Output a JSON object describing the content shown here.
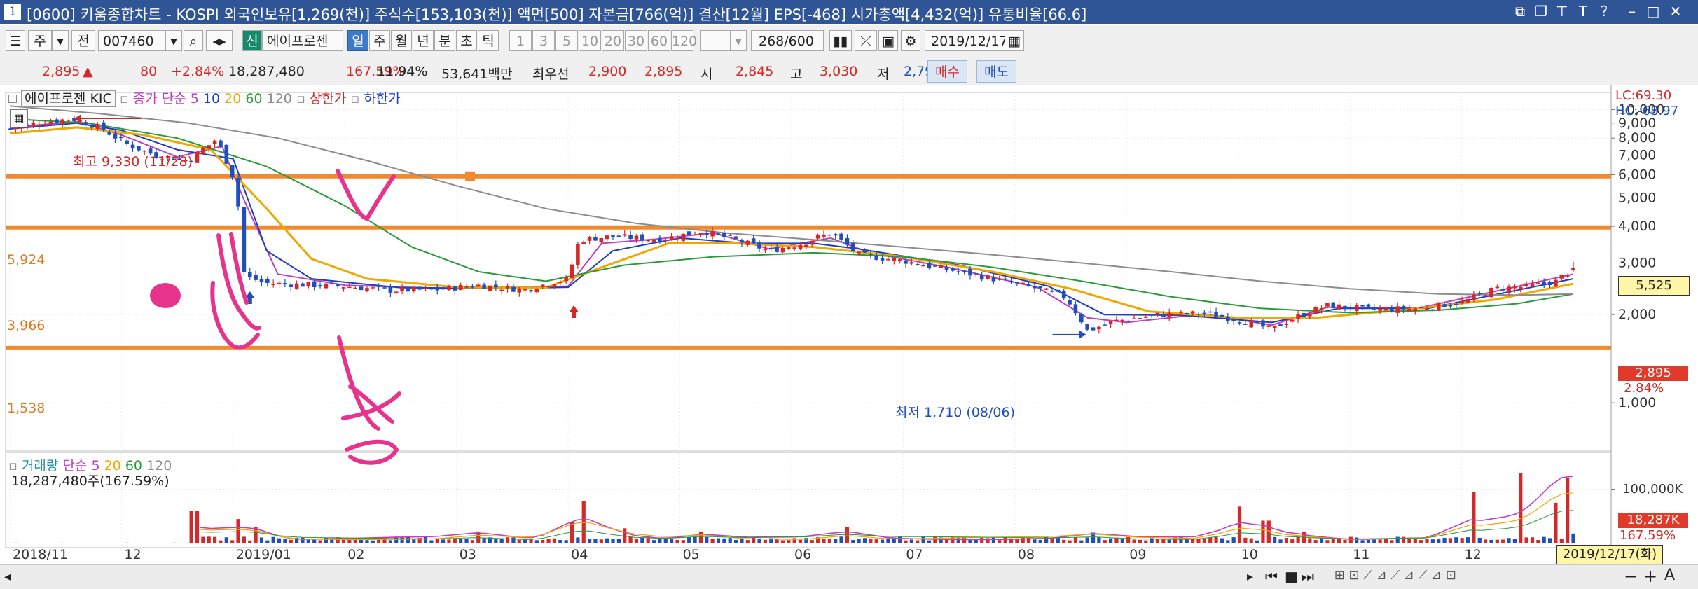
{
  "window": {
    "number": "1",
    "title": "[0600] 키움종합차트 - KOSPI 외국인보유[1,269(천)] 주식수[153,103(천)] 액면[500] 자본금[766(억)] 결산[12월] EPS[-468] 시가총액[4,432(억)] 유통비율[66.6]"
  },
  "toolbar": {
    "period_main": "주",
    "period_prev": "전",
    "stock_code": "007460",
    "stock_badge": "신",
    "stock_name": "에이프로젠",
    "periods": [
      "일",
      "주",
      "월",
      "년",
      "분",
      "초",
      "틱"
    ],
    "selected_period": "일",
    "intervals": [
      "1",
      "3",
      "5",
      "10",
      "20",
      "30",
      "60",
      "120"
    ],
    "count": "268",
    "count_max": "/600",
    "date": "2019/12/17"
  },
  "quote": {
    "price": "2,895",
    "change_arrow": "▲",
    "change": "80",
    "change_pct": "+2.84%",
    "volume": "18,287,480",
    "volume_ratio": "167.59%",
    "turnover": "11.94%",
    "trade_value": "53,641백만",
    "best_ask_label": "최우선",
    "best_ask": "2,900",
    "best_bid": "2,895",
    "open_label": "시",
    "open": "2,845",
    "high_label": "고",
    "high": "3,030",
    "low_label": "저",
    "low": "2,795",
    "buy_button": "매수",
    "sell_button": "매도"
  },
  "price_legend": {
    "stock": "에이프로젠 KIC",
    "ma_label": "종가 단순",
    "ma_periods": [
      "5",
      "10",
      "20",
      "60",
      "120"
    ],
    "upper_limit": "상한가",
    "lower_limit": "하한가",
    "lc": "LC:69.30",
    "hc": "HC:-68.97"
  },
  "volume_legend": {
    "label": "거래량",
    "ma_label": "단순",
    "ma_periods": [
      "5",
      "20",
      "60",
      "120"
    ],
    "current": "18,287,480주(167.59%)"
  },
  "annotations": {
    "high_label": "최고 9,330 (11/28)",
    "low_label": "최저 1,710 (08/06)",
    "hline_labels": [
      "5,924",
      "3,966",
      "1,538"
    ]
  },
  "axis_badges": {
    "cursor_price": "5,525",
    "last_price": "2,895",
    "last_pct": "2.84%",
    "last_volume": "18,287K",
    "last_volume_pct": "167.59%",
    "volume_axis_label": "100,000K",
    "date_badge": "2019/12/17(화)"
  },
  "colors": {
    "up": "#d62828",
    "down": "#1f4fbf",
    "ma5": "#c040c0",
    "ma10": "#1f3fbf",
    "ma20": "#f0a800",
    "ma60": "#2a9a3a",
    "ma120": "#8c8c8c",
    "hline": "#f08a30",
    "marker": "#e8338c"
  },
  "chart_data": [
    {
      "type": "candlestick",
      "title": "에이프로젠 KIC",
      "x_labels": [
        "2018/11",
        "12",
        "2019/01",
        "02",
        "03",
        "04",
        "05",
        "06",
        "07",
        "08",
        "09",
        "10",
        "11",
        "12"
      ],
      "x_label_months": [
        0,
        1,
        2,
        3,
        4,
        5,
        6,
        7,
        8,
        9,
        10,
        11,
        12,
        13
      ],
      "y_ticks": [
        1000,
        2000,
        3000,
        4000,
        5000,
        6000,
        7000,
        8000,
        9000,
        10000
      ],
      "ylim": [
        700,
        11200
      ],
      "log_scale": true,
      "close_path": [
        [
          0.0,
          8600
        ],
        [
          0.25,
          9000
        ],
        [
          0.55,
          9330
        ],
        [
          0.8,
          8700
        ],
        [
          1.05,
          7600
        ],
        [
          1.3,
          7000
        ],
        [
          1.6,
          6700
        ],
        [
          1.85,
          7900
        ],
        [
          2.02,
          5600
        ],
        [
          2.1,
          2700
        ],
        [
          2.3,
          2560
        ],
        [
          2.6,
          2530
        ],
        [
          3.0,
          2500
        ],
        [
          3.4,
          2420
        ],
        [
          3.8,
          2430
        ],
        [
          4.2,
          2520
        ],
        [
          4.6,
          2430
        ],
        [
          5.0,
          2650
        ],
        [
          5.1,
          3600
        ],
        [
          5.4,
          3700
        ],
        [
          5.8,
          3600
        ],
        [
          6.2,
          3850
        ],
        [
          6.5,
          3600
        ],
        [
          6.8,
          3300
        ],
        [
          7.1,
          3500
        ],
        [
          7.35,
          3800
        ],
        [
          7.6,
          3200
        ],
        [
          8.0,
          3050
        ],
        [
          8.4,
          2850
        ],
        [
          8.8,
          2650
        ],
        [
          9.2,
          2450
        ],
        [
          9.45,
          2300
        ],
        [
          9.65,
          1760
        ],
        [
          9.9,
          1900
        ],
        [
          10.3,
          2000
        ],
        [
          10.7,
          2020
        ],
        [
          11.0,
          1920
        ],
        [
          11.3,
          1780
        ],
        [
          11.5,
          1950
        ],
        [
          11.8,
          2150
        ],
        [
          12.2,
          2080
        ],
        [
          12.6,
          2100
        ],
        [
          13.0,
          2200
        ],
        [
          13.3,
          2450
        ],
        [
          13.6,
          2500
        ],
        [
          13.85,
          2600
        ],
        [
          14.0,
          2895
        ]
      ],
      "moving_averages": [
        {
          "name": "5",
          "points": [
            [
              0.0,
              8700
            ],
            [
              0.6,
              9100
            ],
            [
              1.0,
              8200
            ],
            [
              1.5,
              6900
            ],
            [
              1.9,
              7500
            ],
            [
              2.1,
              4900
            ],
            [
              2.4,
              2750
            ],
            [
              3.0,
              2520
            ],
            [
              4.0,
              2450
            ],
            [
              5.0,
              2500
            ],
            [
              5.3,
              3500
            ],
            [
              5.8,
              3620
            ],
            [
              6.3,
              3800
            ],
            [
              6.8,
              3350
            ],
            [
              7.35,
              3650
            ],
            [
              7.7,
              3250
            ],
            [
              8.4,
              2900
            ],
            [
              9.2,
              2480
            ],
            [
              9.65,
              1950
            ],
            [
              10.0,
              1880
            ],
            [
              10.7,
              2010
            ],
            [
              11.3,
              1840
            ],
            [
              11.8,
              2120
            ],
            [
              12.6,
              2100
            ],
            [
              13.3,
              2400
            ],
            [
              14.0,
              2750
            ]
          ]
        },
        {
          "name": "10",
          "points": [
            [
              0.0,
              8600
            ],
            [
              0.6,
              9000
            ],
            [
              1.0,
              8500
            ],
            [
              1.5,
              7300
            ],
            [
              2.0,
              6800
            ],
            [
              2.3,
              3300
            ],
            [
              2.7,
              2650
            ],
            [
              3.5,
              2470
            ],
            [
              4.5,
              2460
            ],
            [
              5.0,
              2480
            ],
            [
              5.4,
              3300
            ],
            [
              6.0,
              3650
            ],
            [
              6.6,
              3500
            ],
            [
              7.2,
              3500
            ],
            [
              7.6,
              3350
            ],
            [
              8.5,
              2950
            ],
            [
              9.3,
              2500
            ],
            [
              9.8,
              2000
            ],
            [
              10.5,
              1990
            ],
            [
              11.3,
              1880
            ],
            [
              11.9,
              2100
            ],
            [
              12.7,
              2100
            ],
            [
              13.4,
              2380
            ],
            [
              14.0,
              2650
            ]
          ]
        },
        {
          "name": "20",
          "points": [
            [
              0.0,
              8300
            ],
            [
              0.6,
              8700
            ],
            [
              1.2,
              8200
            ],
            [
              1.8,
              7300
            ],
            [
              2.3,
              4600
            ],
            [
              2.7,
              3100
            ],
            [
              3.2,
              2650
            ],
            [
              4.0,
              2480
            ],
            [
              4.8,
              2470
            ],
            [
              5.3,
              2900
            ],
            [
              5.9,
              3500
            ],
            [
              6.5,
              3500
            ],
            [
              7.2,
              3400
            ],
            [
              8.0,
              3150
            ],
            [
              8.8,
              2800
            ],
            [
              9.5,
              2450
            ],
            [
              10.2,
              2050
            ],
            [
              11.0,
              1950
            ],
            [
              11.7,
              1950
            ],
            [
              12.5,
              2080
            ],
            [
              13.3,
              2250
            ],
            [
              14.0,
              2550
            ]
          ]
        },
        {
          "name": "60",
          "points": [
            [
              0.0,
              9300
            ],
            [
              0.7,
              9000
            ],
            [
              1.5,
              8000
            ],
            [
              2.3,
              6400
            ],
            [
              3.0,
              4700
            ],
            [
              3.6,
              3400
            ],
            [
              4.2,
              2800
            ],
            [
              4.8,
              2600
            ],
            [
              5.5,
              2950
            ],
            [
              6.3,
              3150
            ],
            [
              7.2,
              3250
            ],
            [
              8.0,
              3150
            ],
            [
              8.8,
              2900
            ],
            [
              9.6,
              2600
            ],
            [
              10.4,
              2300
            ],
            [
              11.2,
              2100
            ],
            [
              12.0,
              2030
            ],
            [
              12.8,
              2070
            ],
            [
              13.5,
              2180
            ],
            [
              14.0,
              2350
            ]
          ]
        },
        {
          "name": "120",
          "points": [
            [
              0.0,
              10300
            ],
            [
              0.8,
              9700
            ],
            [
              1.6,
              9000
            ],
            [
              2.4,
              8000
            ],
            [
              3.2,
              6700
            ],
            [
              4.0,
              5500
            ],
            [
              4.8,
              4600
            ],
            [
              5.6,
              4100
            ],
            [
              6.4,
              3800
            ],
            [
              7.2,
              3600
            ],
            [
              8.0,
              3400
            ],
            [
              8.8,
              3200
            ],
            [
              9.6,
              3000
            ],
            [
              10.4,
              2800
            ],
            [
              11.2,
              2600
            ],
            [
              12.0,
              2450
            ],
            [
              12.8,
              2350
            ],
            [
              13.5,
              2330
            ],
            [
              14.0,
              2350
            ]
          ]
        }
      ],
      "horizontal_lines": [
        5924,
        3966,
        1538
      ],
      "highest": {
        "month": 0.55,
        "value": 9330,
        "label": "최고 9,330 (11/28)"
      },
      "lowest": {
        "month": 9.65,
        "value": 1710,
        "label": "최저 1,710 (08/06)"
      },
      "last": {
        "open": 2845,
        "high": 3030,
        "low": 2795,
        "close": 2895,
        "change_pct": 2.84
      }
    },
    {
      "type": "bar",
      "title": "거래량",
      "unit": "K",
      "y_ticks": [
        100000
      ],
      "ymax": 160000,
      "spikes": [
        [
          1.65,
          60000
        ],
        [
          2.05,
          45000
        ],
        [
          2.2,
          30000
        ],
        [
          4.2,
          22000
        ],
        [
          5.05,
          40000
        ],
        [
          5.15,
          78000
        ],
        [
          5.5,
          28000
        ],
        [
          6.2,
          22000
        ],
        [
          7.5,
          30000
        ],
        [
          9.7,
          20000
        ],
        [
          11.0,
          68000
        ],
        [
          11.25,
          42000
        ],
        [
          11.6,
          22000
        ],
        [
          13.1,
          95000
        ],
        [
          13.55,
          130000
        ],
        [
          13.85,
          75000
        ],
        [
          13.95,
          120000
        ],
        [
          14.0,
          155000
        ],
        [
          14.03,
          18287
        ]
      ],
      "baseline": 9000,
      "last": {
        "value": 18287,
        "ratio_pct": 167.59
      }
    }
  ]
}
